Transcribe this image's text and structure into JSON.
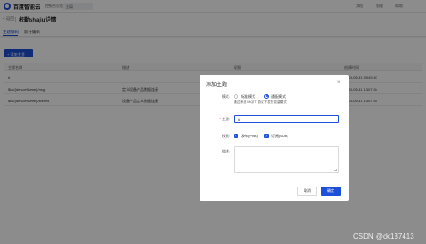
{
  "topbar": {
    "logo": "百度智能云",
    "nav": [
      "控制台总览",
      "全局"
    ],
    "right": [
      "文档",
      "管理",
      "帮助"
    ]
  },
  "header": {
    "back": "< 返回",
    "title": "校勤shajiu详情"
  },
  "tabs": [
    {
      "label": "主题编码",
      "active": true
    },
    {
      "label": "影子编码",
      "active": false
    }
  ],
  "toolbar": {
    "add_label": "+ 添加主题"
  },
  "table": {
    "columns": [
      "主题名称",
      "描述",
      "权限",
      "创建时间"
    ],
    "rows": [
      [
        "#",
        "",
        "",
        "2023-05-31 09:49:07"
      ],
      [
        "$iot/{deviceName}/msg",
        "定义设备产品数据连接",
        "",
        "2023-05-31 13:07:04"
      ],
      [
        "$iot/{deviceName}/events",
        "设备产品定义数据连接",
        "",
        "2023-05-31 13:07:04"
      ]
    ]
  },
  "dialog": {
    "title": "添加主题",
    "close": "×",
    "type_label": "模式:",
    "type_options": [
      {
        "label": "标准模式",
        "selected": false
      },
      {
        "label": "通配模式",
        "selected": true
      }
    ],
    "type_hint": "通过系统 MQTT 协议下发布变量模式",
    "topic_label": "主题:",
    "topic_value": "#",
    "perm_label": "权限:",
    "perm_options": [
      {
        "label": "发布(PUB)",
        "checked": true
      },
      {
        "label": "订阅(SUB)",
        "checked": true
      }
    ],
    "desc_label": "描述:",
    "cancel_label": "取消",
    "ok_label": "确定"
  },
  "watermark": "CSDN @ck137413",
  "colors": {
    "accent": "#1e4fd8",
    "overlay": "rgba(0,0,0,0.45)"
  }
}
